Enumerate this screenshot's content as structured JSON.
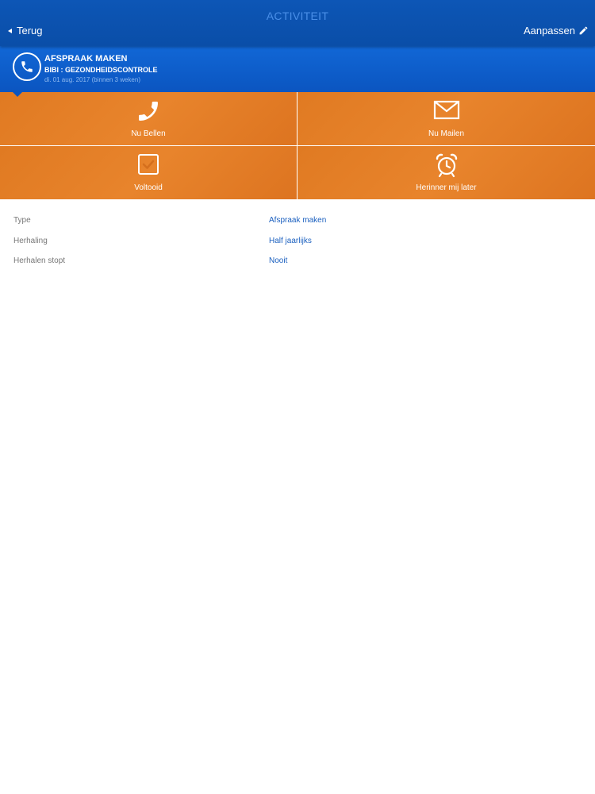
{
  "topbar": {
    "title": "ACTIVITEIT",
    "back_label": "Terug",
    "edit_label": "Aanpassen"
  },
  "header": {
    "icon": "phone-icon",
    "title": "AFSPRAAK MAKEN",
    "subtitle": "BIBI : GEZONDHEIDSCONTROLE",
    "date": "di. 01 aug. 2017 (binnen 3 weken)"
  },
  "actions": [
    {
      "label": "Nu Bellen",
      "icon": "phone-icon"
    },
    {
      "label": "Nu Mailen",
      "icon": "mail-icon"
    },
    {
      "label": "Voltooid",
      "icon": "checkbox-icon"
    },
    {
      "label": "Herinner mij later",
      "icon": "alarm-clock-icon"
    }
  ],
  "details": [
    {
      "key": "Type",
      "value": "Afspraak maken"
    },
    {
      "key": "Herhaling",
      "value": "Half jaarlijks"
    },
    {
      "key": "Herhalen stopt",
      "value": "Nooit"
    }
  ],
  "colors": {
    "nav_blue": "#0d56b6",
    "header_blue": "#1167d6",
    "action_orange": "#e07a22",
    "value_blue": "#1a5fbf",
    "label_gray": "#777777"
  }
}
